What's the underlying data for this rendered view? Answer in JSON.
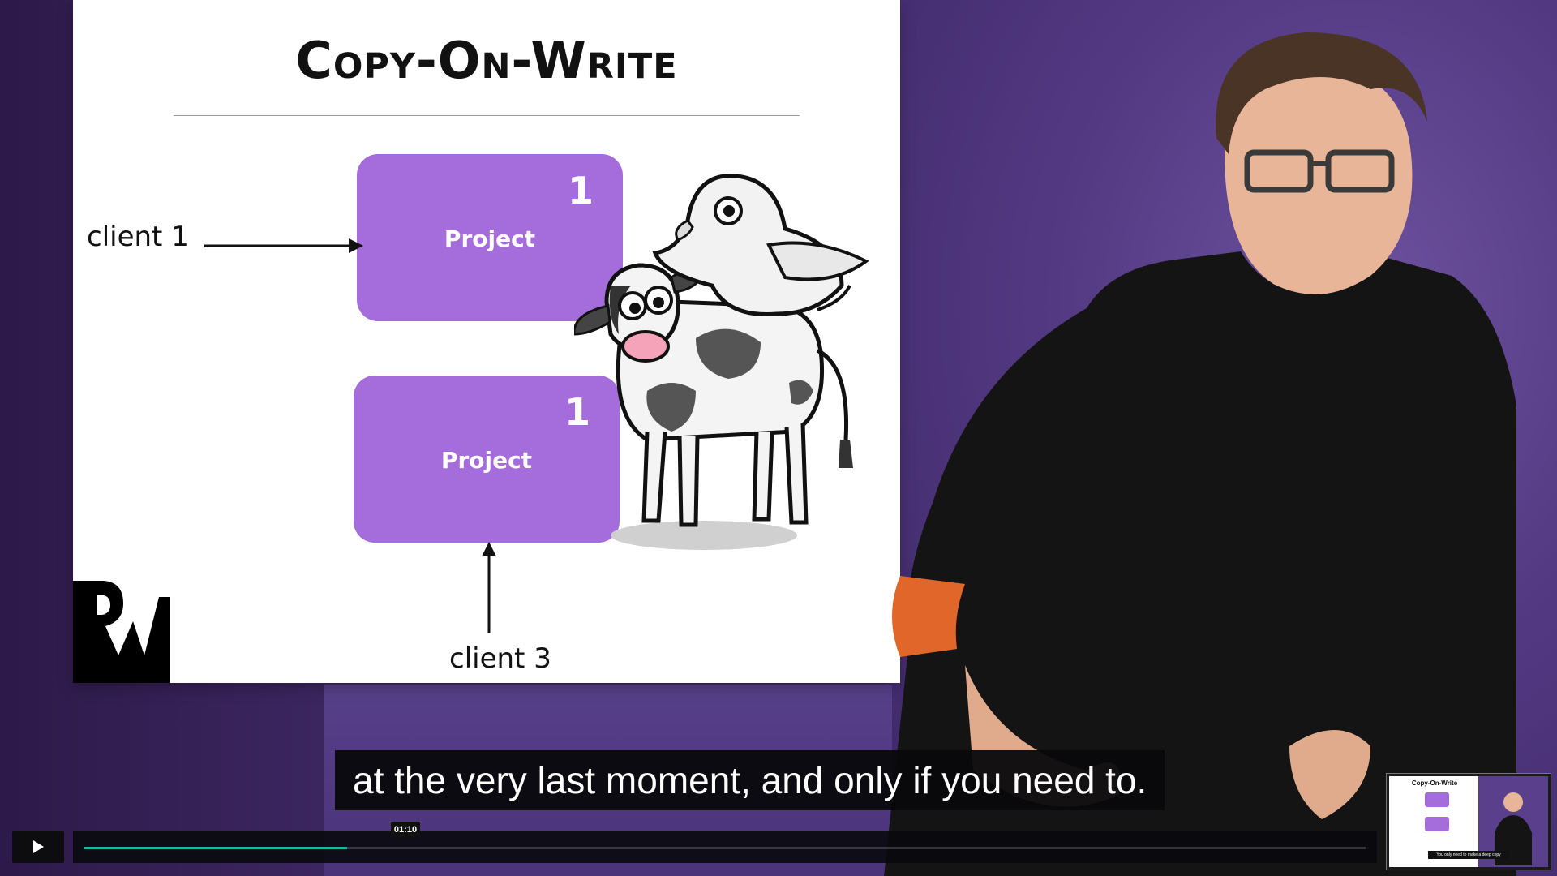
{
  "slide": {
    "title": "Copy-On-Write",
    "project_top": {
      "label": "Project",
      "count": "1"
    },
    "project_bottom": {
      "label": "Project",
      "count": "1"
    },
    "client_left": "client 1",
    "client_bottom": "client 3"
  },
  "caption": "at the very last moment, and only if you need to.",
  "player": {
    "play_icon": "play-icon",
    "current_time": "01:10",
    "progress_fraction": 0.205,
    "accent_color": "#20b2a0"
  },
  "thumbnail": {
    "title": "Copy-On-Write",
    "caption": "You only need to make a deep copy"
  },
  "colors": {
    "project_box": "#a56ddc",
    "background": "#4b3379"
  }
}
